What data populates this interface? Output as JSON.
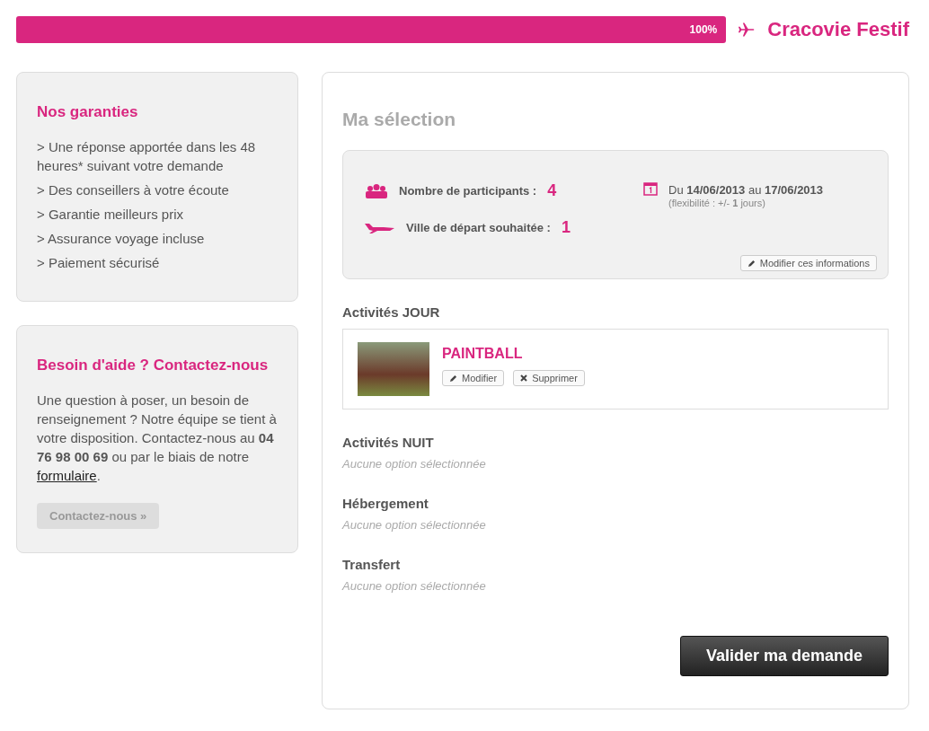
{
  "progress": {
    "level": 1,
    "label": "100%"
  },
  "trip_title": "Cracovie Festif",
  "guarantees": {
    "title": "Nos garanties",
    "items": [
      "> Une réponse apportée dans les 48 heures* suivant votre demande",
      "> Des conseillers à votre écoute",
      "> Garantie meilleurs prix",
      "> Assurance voyage incluse",
      "> Paiement sécurisé"
    ]
  },
  "help": {
    "title": "Besoin d'aide ? Contactez-nous",
    "text_before": "Une question à poser, un besoin de renseignement ? Notre équipe se tient à votre disposition. Contactez-nous au **04 76 98 00 69** ou par le biais de notre ",
    "link": "formulaire",
    "text_after": ".",
    "button": "Contactez-nous »"
  },
  "selection": {
    "title": "Ma sélection",
    "participants_label": "Nombre de participants :",
    "participants_value": "4",
    "departure_label": "Ville de départ souhaitée :",
    "departure_value": "1",
    "dates": "Du **14/06/2013** au **17/06/2013**",
    "flexibility": "(flexibilité : +/- **1** jours)",
    "edit_button": "Modifier ces informations",
    "sections": [
      {
        "kind": "activities",
        "title": "Activités JOUR",
        "items": [
          {
            "name": "PAINTBALL",
            "edit": "Modifier",
            "remove": "Supprimer"
          }
        ]
      },
      {
        "kind": "empty",
        "title": "Activités NUIT",
        "placeholder": "Aucune option sélectionnée"
      },
      {
        "kind": "empty",
        "title": "Hébergement",
        "placeholder": "Aucune option sélectionnée"
      },
      {
        "kind": "empty",
        "title": "Transfert",
        "placeholder": "Aucune option sélectionnée"
      }
    ],
    "submit": "Valider ma demande"
  }
}
